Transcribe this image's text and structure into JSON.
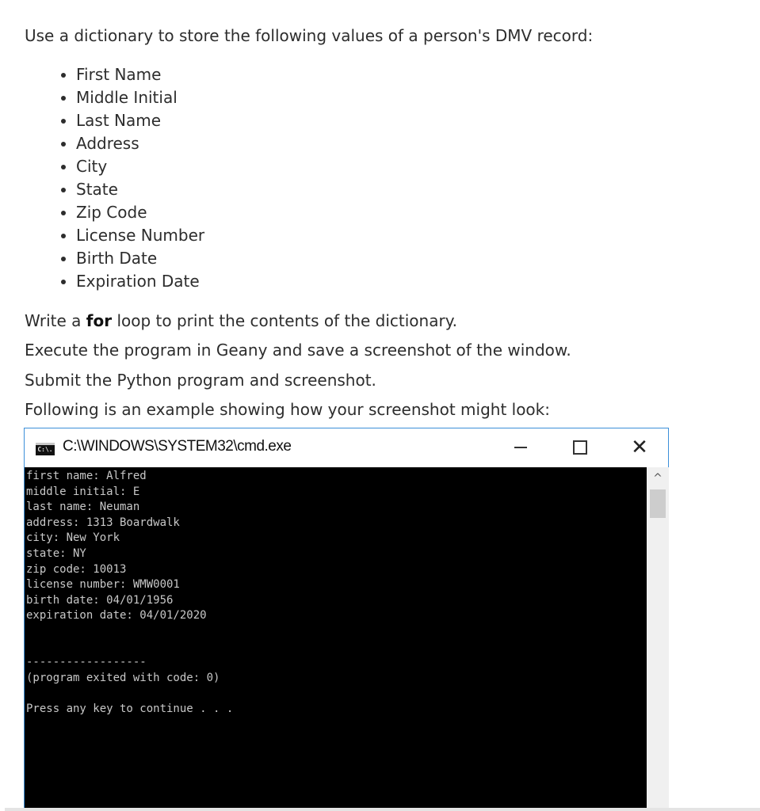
{
  "intro": "Use a dictionary to store the following values of a person's DMV record:",
  "fields": [
    "First Name",
    "Middle Initial",
    "Last Name",
    "Address",
    "City",
    "State",
    "Zip Code",
    "License Number",
    "Birth Date",
    "Expiration Date"
  ],
  "instructions": {
    "loop_prefix": "Write a ",
    "loop_bold": "for",
    "loop_suffix": " loop to print the contents of the dictionary.",
    "execute": "Execute the program in Geany and save a screenshot of the window.",
    "submit": "Submit the Python program and screenshot.",
    "example": "Following is an example showing how your screenshot might look:"
  },
  "window": {
    "title": "C:\\WINDOWS\\SYSTEM32\\cmd.exe",
    "icon": "C:\\.",
    "close_glyph": "✕",
    "scroll_up_glyph": "^"
  },
  "console": {
    "lines": [
      "first name: Alfred",
      "middle initial: E",
      "last name: Neuman",
      "address: 1313 Boardwalk",
      "city: New York",
      "state: NY",
      "zip code: 10013",
      "license number: WMW0001",
      "birth date: 04/01/1956",
      "expiration date: 04/01/2020",
      "",
      "",
      "------------------",
      "(program exited with code: 0)",
      "",
      "Press any key to continue . . ."
    ]
  }
}
